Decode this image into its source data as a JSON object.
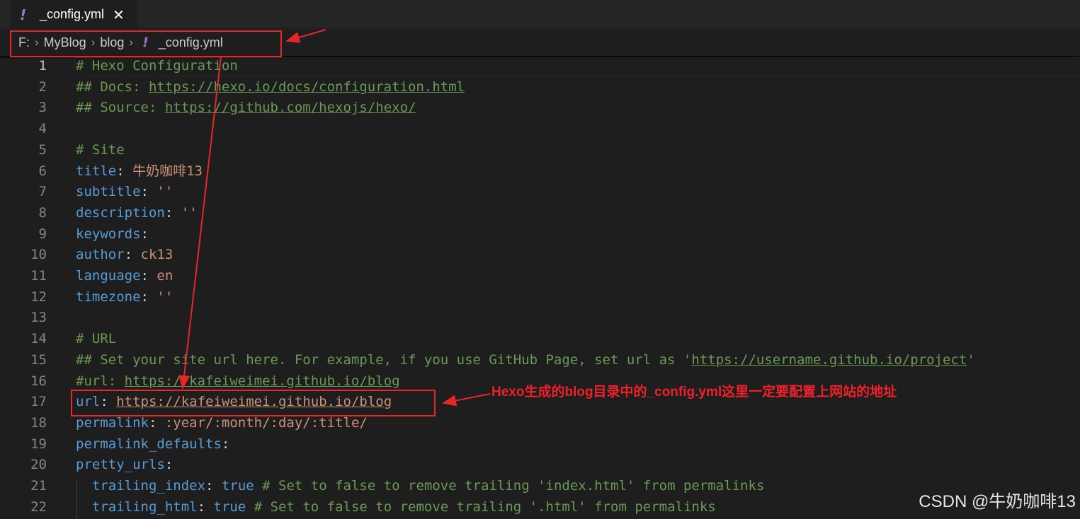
{
  "tab": {
    "icon": "yaml-exclamation-icon",
    "icon_glyph": "!",
    "filename": "_config.yml",
    "close_glyph": "✕"
  },
  "breadcrumb": {
    "items": [
      "F:",
      "MyBlog",
      "blog"
    ],
    "separator": "›",
    "file_icon": "!",
    "file": "_config.yml"
  },
  "editor": {
    "lines": [
      {
        "n": "1",
        "parts": [
          [
            "c",
            "# Hexo Configuration"
          ]
        ]
      },
      {
        "n": "2",
        "parts": [
          [
            "c",
            "## Docs: "
          ],
          [
            "cu",
            "https://hexo.io/docs/configuration.html"
          ]
        ]
      },
      {
        "n": "3",
        "parts": [
          [
            "c",
            "## Source: "
          ],
          [
            "cu",
            "https://github.com/hexojs/hexo/"
          ]
        ]
      },
      {
        "n": "4",
        "parts": []
      },
      {
        "n": "5",
        "parts": [
          [
            "c",
            "# Site"
          ]
        ]
      },
      {
        "n": "6",
        "parts": [
          [
            "k",
            "title"
          ],
          [
            "p",
            ": "
          ],
          [
            "v",
            "牛奶咖啡13"
          ]
        ]
      },
      {
        "n": "7",
        "parts": [
          [
            "k",
            "subtitle"
          ],
          [
            "p",
            ": "
          ],
          [
            "v",
            "''"
          ]
        ]
      },
      {
        "n": "8",
        "parts": [
          [
            "k",
            "description"
          ],
          [
            "p",
            ": "
          ],
          [
            "v",
            "''"
          ]
        ]
      },
      {
        "n": "9",
        "parts": [
          [
            "k",
            "keywords"
          ],
          [
            "p",
            ":"
          ]
        ]
      },
      {
        "n": "10",
        "parts": [
          [
            "k",
            "author"
          ],
          [
            "p",
            ": "
          ],
          [
            "v",
            "ck13"
          ]
        ]
      },
      {
        "n": "11",
        "parts": [
          [
            "k",
            "language"
          ],
          [
            "p",
            ": "
          ],
          [
            "v",
            "en"
          ]
        ]
      },
      {
        "n": "12",
        "parts": [
          [
            "k",
            "timezone"
          ],
          [
            "p",
            ": "
          ],
          [
            "v",
            "''"
          ]
        ]
      },
      {
        "n": "13",
        "parts": []
      },
      {
        "n": "14",
        "parts": [
          [
            "c",
            "# URL"
          ]
        ]
      },
      {
        "n": "15",
        "parts": [
          [
            "c",
            "## Set your site url here. For example, if you use GitHub Page, set url as '"
          ],
          [
            "cu",
            "https://username.github.io/project"
          ],
          [
            "c",
            "'"
          ]
        ]
      },
      {
        "n": "16",
        "parts": [
          [
            "c",
            "#url: "
          ],
          [
            "cu",
            "https://kafeiweimei.github.io/blog"
          ]
        ]
      },
      {
        "n": "17",
        "parts": [
          [
            "k",
            "url"
          ],
          [
            "p",
            ": "
          ],
          [
            "u",
            "https://kafeiweimei.github.io/blog"
          ]
        ]
      },
      {
        "n": "18",
        "parts": [
          [
            "k",
            "permalink"
          ],
          [
            "p",
            ": "
          ],
          [
            "v",
            ":year/:month/:day/:title/"
          ]
        ]
      },
      {
        "n": "19",
        "parts": [
          [
            "k",
            "permalink_defaults"
          ],
          [
            "p",
            ":"
          ]
        ]
      },
      {
        "n": "20",
        "parts": [
          [
            "k",
            "pretty_urls"
          ],
          [
            "p",
            ":"
          ]
        ]
      },
      {
        "n": "21",
        "parts": [
          [
            "p",
            "  "
          ],
          [
            "k",
            "trailing_index"
          ],
          [
            "p",
            ": "
          ],
          [
            "k",
            "true"
          ],
          [
            "c",
            " # Set to false to remove trailing 'index.html' from permalinks"
          ]
        ]
      },
      {
        "n": "22",
        "parts": [
          [
            "p",
            "  "
          ],
          [
            "k",
            "trailing_html"
          ],
          [
            "p",
            ": "
          ],
          [
            "k",
            "true"
          ],
          [
            "c",
            " # Set to false to remove trailing '.html' from permalinks"
          ]
        ]
      }
    ]
  },
  "annotation": {
    "note": "Hexo生成的blog目录中的_config.yml这里一定要配置上网站的地址",
    "color": "#e8262a"
  },
  "watermark": "CSDN @牛奶咖啡13"
}
